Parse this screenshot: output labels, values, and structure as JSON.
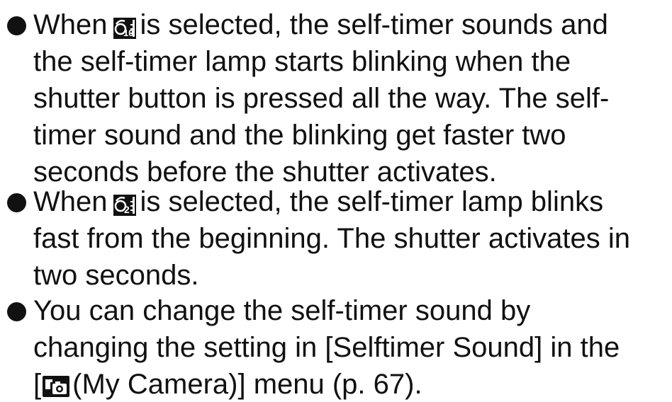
{
  "items": [
    {
      "lines": [
        {
          "pre": "When",
          "post": "is selected, the self-timer sounds and"
        },
        "the self-timer lamp starts blinking when the",
        "shutter button is pressed all the way. The self-",
        "timer sound and the blinking get faster two",
        "seconds before the shutter activates."
      ]
    },
    {
      "lines": [
        {
          "pre": "When",
          "post": "is selected, the self-timer lamp blinks"
        },
        "fast from the beginning. The shutter activates in",
        "two seconds."
      ]
    },
    {
      "lines": [
        "You can change the self-timer sound by",
        "changing the setting in [Selftimer Sound] in the",
        {
          "pre": "[",
          "post": "(My Camera)] menu (p. 67)."
        }
      ]
    }
  ],
  "icons": {
    "timer10": "self-timer-10s-icon",
    "timer2": "self-timer-2s-icon",
    "mycamera": "my-camera-icon"
  },
  "colors": {
    "text": "#111111",
    "icon_fill": "#111111"
  }
}
